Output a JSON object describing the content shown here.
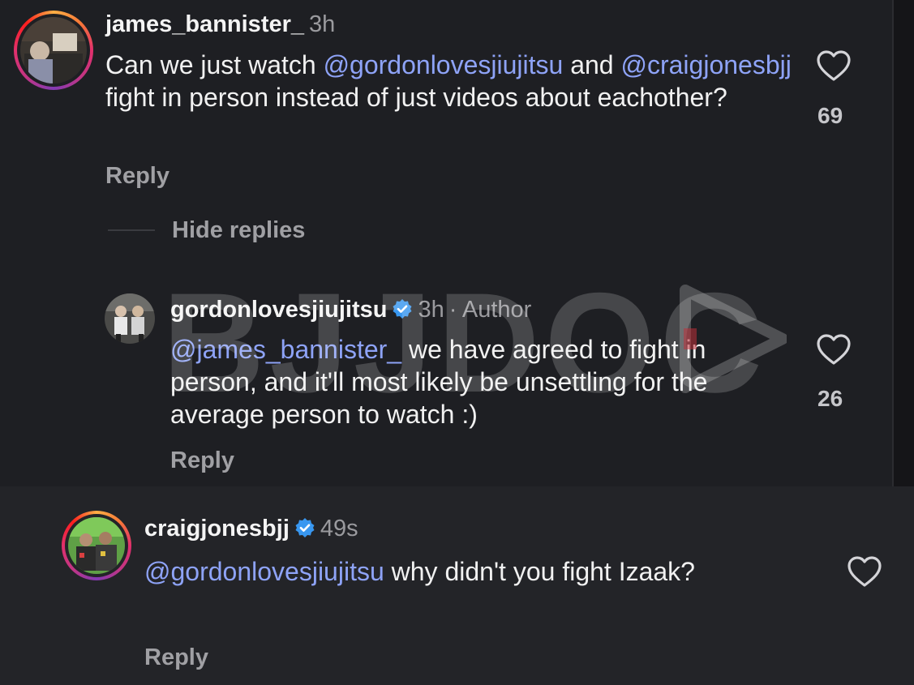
{
  "comments": [
    {
      "username": "james_bannister_",
      "time": "3h",
      "text_parts": [
        "Can we just watch ",
        "@gordonlovesjiujitsu",
        " and ",
        "@craigjonesbjj",
        " fight in person instead of just videos about eachother?"
      ],
      "likes": "69",
      "reply_label": "Reply",
      "hide_replies_label": "Hide replies"
    },
    {
      "username": "gordonlovesjiujitsu",
      "verified": true,
      "time": "3h",
      "author_label": "· Author",
      "text_parts": [
        "@james_bannister_",
        " we have agreed to fight in person, and it'll most likely be unsettling for the average person to watch :)"
      ],
      "likes": "26",
      "reply_label": "Reply"
    },
    {
      "username": "craigjonesbjj",
      "verified": true,
      "time": "49s",
      "text_parts": [
        "@gordonlovesjiujitsu",
        " why didn't you fight Izaak?"
      ],
      "reply_label": "Reply"
    }
  ],
  "watermark": "BJJDOC",
  "icons": {
    "like": "heart-outline-icon",
    "verified": "verified-badge-icon",
    "watermark_play": "play-triangle-icon"
  },
  "colors": {
    "mention": "#8ea3f7",
    "verified": "#3897f0"
  }
}
